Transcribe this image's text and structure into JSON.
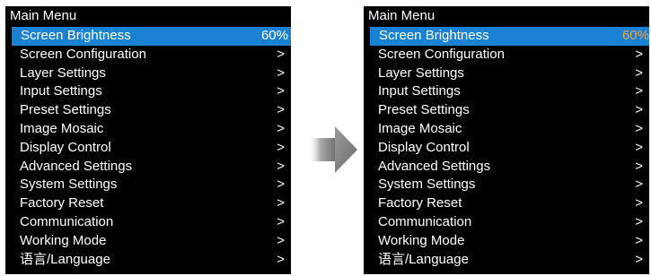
{
  "colors": {
    "screen_background": "#000000",
    "menu_text": "#ffffff",
    "selection_highlight": "#1a82d3",
    "value_highlight_after": "#f0a24a",
    "arrow_gray": "#8c8c8c"
  },
  "before": {
    "title": "Main Menu",
    "items": [
      {
        "label": "Screen Brightness",
        "value": "60%"
      },
      {
        "label": "Screen Configuration",
        "value": ">"
      },
      {
        "label": "Layer Settings",
        "value": ">"
      },
      {
        "label": "Input Settings",
        "value": ">"
      },
      {
        "label": "Preset Settings",
        "value": ">"
      },
      {
        "label": "Image Mosaic",
        "value": ">"
      },
      {
        "label": "Display Control",
        "value": ">"
      },
      {
        "label": "Advanced Settings",
        "value": ">"
      },
      {
        "label": "System Settings",
        "value": ">"
      },
      {
        "label": "Factory Reset",
        "value": ">"
      },
      {
        "label": "Communication",
        "value": ">"
      },
      {
        "label": "Working Mode",
        "value": ">"
      },
      {
        "label": "语言/Language",
        "value": ">"
      }
    ]
  },
  "transition_icon": "right-arrow-icon",
  "after": {
    "title": "Main Menu",
    "items": [
      {
        "label": "Screen Brightness",
        "value": "60%"
      },
      {
        "label": "Screen Configuration",
        "value": ">"
      },
      {
        "label": "Layer Settings",
        "value": ">"
      },
      {
        "label": "Input Settings",
        "value": ">"
      },
      {
        "label": "Preset Settings",
        "value": ">"
      },
      {
        "label": "Image Mosaic",
        "value": ">"
      },
      {
        "label": "Display Control",
        "value": ">"
      },
      {
        "label": "Advanced Settings",
        "value": ">"
      },
      {
        "label": "System Settings",
        "value": ">"
      },
      {
        "label": "Factory Reset",
        "value": ">"
      },
      {
        "label": "Communication",
        "value": ">"
      },
      {
        "label": "Working Mode",
        "value": ">"
      },
      {
        "label": "语言/Language",
        "value": ">"
      }
    ]
  }
}
